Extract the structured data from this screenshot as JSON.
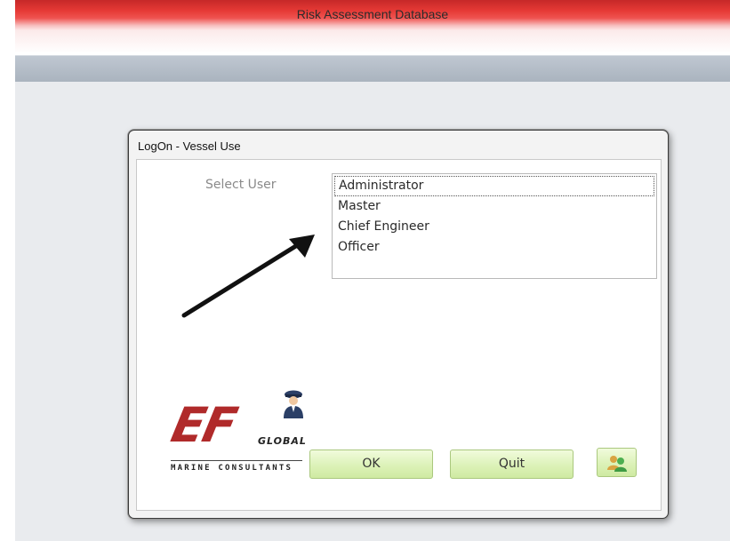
{
  "window": {
    "title": "Risk Assessment Database"
  },
  "dialog": {
    "title": "LogOn - Vessel Use",
    "select_label": "Select User",
    "users": [
      {
        "label": "Administrator",
        "selected": true
      },
      {
        "label": "Master",
        "selected": false
      },
      {
        "label": "Chief Engineer",
        "selected": false
      },
      {
        "label": "Officer",
        "selected": false
      }
    ],
    "buttons": {
      "ok_label": "OK",
      "quit_label": "Quit",
      "users_icon": "users-icon"
    }
  },
  "logo": {
    "brand": "EF",
    "sub_brand": "GLOBAL",
    "tagline": "MARINE CONSULTANTS",
    "icon": "ship-captain-icon"
  },
  "colors": {
    "title_bar": "#e53935",
    "button_green": "#dcf2b8",
    "logo_red": "#b02a2a"
  }
}
